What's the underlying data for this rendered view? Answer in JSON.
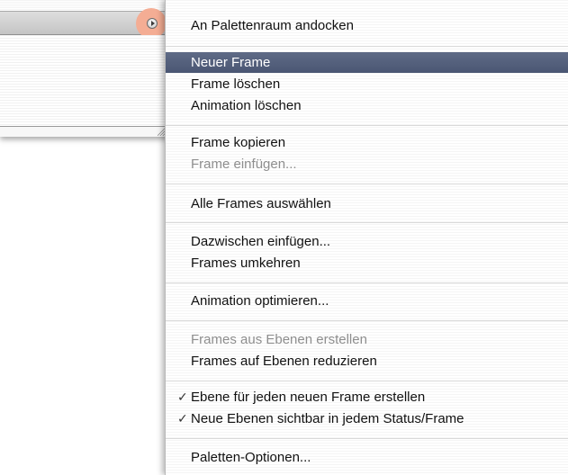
{
  "menu": {
    "items": [
      {
        "label": "An Palettenraum andocken",
        "enabled": true
      },
      {
        "label": "Neuer Frame",
        "enabled": true,
        "selected": true
      },
      {
        "label": "Frame löschen",
        "enabled": true
      },
      {
        "label": "Animation löschen",
        "enabled": true
      },
      {
        "label": "Frame kopieren",
        "enabled": true
      },
      {
        "label": "Frame einfügen...",
        "enabled": false
      },
      {
        "label": "Alle Frames auswählen",
        "enabled": true
      },
      {
        "label": "Dazwischen einfügen...",
        "enabled": true
      },
      {
        "label": "Frames umkehren",
        "enabled": true
      },
      {
        "label": "Animation optimieren...",
        "enabled": true
      },
      {
        "label": "Frames aus Ebenen erstellen",
        "enabled": false
      },
      {
        "label": "Frames auf Ebenen reduzieren",
        "enabled": true
      },
      {
        "label": "Ebene für jeden neuen Frame erstellen",
        "enabled": true,
        "checked": true
      },
      {
        "label": "Neue Ebenen sichtbar in jedem Status/Frame",
        "enabled": true,
        "checked": true
      },
      {
        "label": "Paletten-Optionen...",
        "enabled": true
      }
    ],
    "checkmark_glyph": "✓"
  },
  "palette": {
    "menu_button_icon": "palette-menu-triangle-icon",
    "highlight_color": "#f4ad94"
  },
  "colors": {
    "selection": "#5a6680",
    "disabled_text": "#8e8e8e"
  }
}
